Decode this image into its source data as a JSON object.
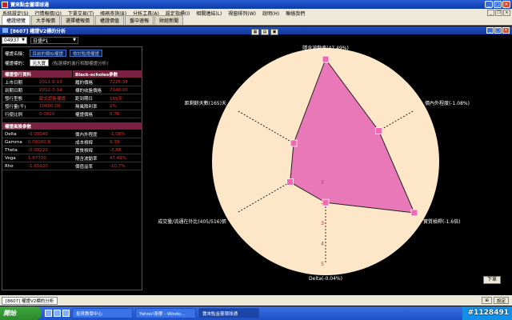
{
  "window": {
    "title": "寶來點金靈環球通"
  },
  "menu": [
    "系統設定(S)",
    "行情報價(Q)",
    "下單交易(T)",
    "帳務查詢(B)",
    "分析工具(A)",
    "設定指標(I)",
    "相關連結(L)",
    "視窗排列(W)",
    "說明(H)",
    "聯絡我們"
  ],
  "tabs": [
    "權證總覽",
    "大手報價",
    "選擇權報價",
    "權證價值",
    "盤中速報",
    "財經新聞"
  ],
  "subwin": {
    "title": "[8607] 權證V2標的分析"
  },
  "toolbar": {
    "code": "04937",
    "underlying": "日盛P1"
  },
  "panel": {
    "name_label": "權證名稱：",
    "name_value": "日盛P1",
    "related_btn": "目前的類似權證",
    "view_btn": "檢討點燈權證",
    "underlying_label": "權證標的：",
    "underlying_value": "元大寶",
    "note": "(點選標的進行相關權證分析)",
    "basic_header": "權證發行資料",
    "bs_header": "Black-scholes參數",
    "basic_rows": [
      {
        "label": "上市日期",
        "value": "2011-9-13"
      },
      {
        "label": "到期日期",
        "value": "2012-7-14"
      },
      {
        "label": "發行型態",
        "value": "歐式認售權證"
      },
      {
        "label": "發行量(千)",
        "value": "10000.00"
      },
      {
        "label": "行使比例",
        "value": "0.0010"
      }
    ],
    "bs_rows": [
      {
        "label": "履約價格",
        "value": "7225.38"
      },
      {
        "label": "標的收盤價格",
        "value": "7140.00"
      },
      {
        "label": "距到期日",
        "value": "165天"
      },
      {
        "label": "無風險利率",
        "value": "2%"
      },
      {
        "label": "權證價格",
        "value": "0.76"
      }
    ],
    "greeks_header": "權證風險參數",
    "greeks": [
      {
        "name": "Delta",
        "value": "-0.00040",
        "label2": "價內外程度",
        "value2": "-1.08%"
      },
      {
        "name": "Gamma",
        "value": "0.00000 8",
        "label2": "成本槓桿",
        "value2": "9.39"
      },
      {
        "name": "Theta",
        "value": "-0.00220",
        "label2": "實質槓桿",
        "value2": "-3.88"
      },
      {
        "name": "Vega",
        "value": "1.87700",
        "label2": "隱含波動率",
        "value2": "47.49%"
      },
      {
        "name": "Rho",
        "value": "-1.65920",
        "label2": "價值溢率",
        "value2": "-10.7%"
      }
    ]
  },
  "chart_data": {
    "type": "radar",
    "axes": [
      "隱含波動率(47.49%)",
      "價內外程度(-1.08%)",
      "實質槓桿(-1.6倍)",
      "Delta(-0.04%)",
      "成交量/流通在外比(405/516)張",
      "距剩餘天數(165)天"
    ],
    "values": [
      5,
      3,
      5,
      2,
      2,
      1.8
    ],
    "scale": [
      1,
      2,
      3,
      4,
      5
    ],
    "fill_color": "#e878b8",
    "background_color": "#fde7c8",
    "marker_color": "#f06ab0"
  },
  "bottom": {
    "down_btn": "下單",
    "status_item": "[8607] 權證V2標的分析",
    "status_right": [
      "⊞",
      "設定"
    ]
  },
  "taskbar": {
    "start": "開始",
    "buttons": [
      "投資教學中心",
      "Yahoo!奇摩 - Windo...",
      "寶來點金靈環球通"
    ]
  },
  "watermark": "#1128491"
}
